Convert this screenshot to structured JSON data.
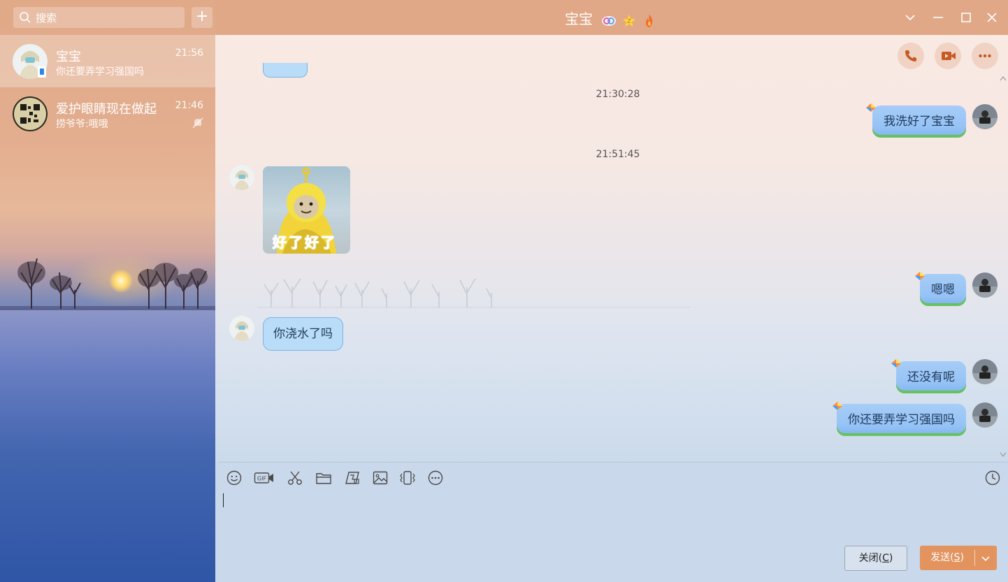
{
  "window": {
    "title": "宝宝",
    "title_badges": [
      "qq-vip-badge-icon",
      "star-badge-icon",
      "flame-badge-icon"
    ],
    "accent_color": "#e0a887"
  },
  "search": {
    "placeholder": "搜索"
  },
  "add_button": {
    "label": "+"
  },
  "conversations": [
    {
      "name": "宝宝",
      "preview": "你还要弄学习强国吗",
      "time": "21:56",
      "active": true,
      "status": "mobile-online-icon"
    },
    {
      "name": "爱护眼睛现在做起",
      "preview": "捞爷爷:哦哦",
      "time": "21:46",
      "active": false,
      "status": "muted-bell-icon"
    }
  ],
  "chat_header": {
    "buttons": [
      "phone-call-icon",
      "video-call-icon",
      "more-options-icon"
    ]
  },
  "messages": {
    "ts1": "21:30:28",
    "m1": "我洗好了宝宝",
    "ts2": "21:51:45",
    "sticker_text": "好了好了",
    "m2": "嗯嗯",
    "m3": "你浇水了吗",
    "m4": "还没有呢",
    "m5": "你还要弄学习强国吗"
  },
  "toolbar": {
    "icons": [
      "emoji-icon",
      "gif-icon",
      "screenshot-scissors-icon",
      "folder-icon",
      "screen-record-icon",
      "image-icon",
      "shake-window-icon",
      "more-icon",
      "history-clock-icon"
    ]
  },
  "input": {
    "value": ""
  },
  "buttons": {
    "close": "关闭(",
    "close_key": "C",
    "close_end": ")",
    "send": "发送(",
    "send_key": "S",
    "send_end": ")"
  },
  "colors": {
    "send_button": "#e2935e",
    "bubble_outgoing": "#a7cdf7",
    "bubble_incoming": "#b9dcf8",
    "bubble_accent": "#67c15d"
  }
}
